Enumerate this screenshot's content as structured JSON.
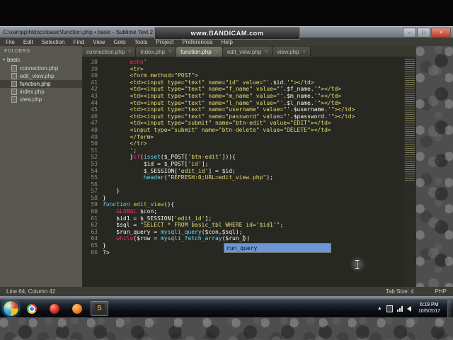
{
  "colors": {
    "editor_bg": "#272822",
    "keyword": "#f92672",
    "string": "#e6db74",
    "function_def": "#a6e22e",
    "builtin": "#66d9ef",
    "text": "#f8f8f2",
    "line_number": "#8f908a",
    "selection_blue": "#6d96d4",
    "close_button": "#bd3a28"
  },
  "watermark": {
    "text": "www.BANDICAM.com"
  },
  "title_bar": {
    "title": "C:\\xampp\\htdocs\\basic\\function.php • basic - Sublime Text 2 (UNREGISTERED)",
    "minimize_glyph": "–",
    "maximize_glyph": "□",
    "close_glyph": "×"
  },
  "menu": {
    "items": [
      "File",
      "Edit",
      "Selection",
      "Find",
      "View",
      "Goto",
      "Tools",
      "Project",
      "Preferences",
      "Help"
    ]
  },
  "tabs": {
    "close_glyph": "×",
    "items": [
      {
        "label": "connection.php",
        "active": false
      },
      {
        "label": "index.php",
        "active": false
      },
      {
        "label": "function.php",
        "active": true
      },
      {
        "label": "edit_view.php",
        "active": false
      },
      {
        "label": "view.php",
        "active": false
      }
    ]
  },
  "sidebar": {
    "header": "FOLDERS",
    "folder_arrow": "▾",
    "root": "basic",
    "selected": "function.php",
    "files": [
      "connection.php",
      "edit_view.php",
      "function.php",
      "index.php",
      "view.php"
    ]
  },
  "editor": {
    "lines": [
      {
        "n": 38,
        "s": [
          [
            "w",
            "        "
          ],
          [
            "k",
            "echo"
          ],
          [
            "s",
            "'"
          ]
        ]
      },
      {
        "n": 39,
        "s": [
          [
            "s",
            "        <tr>"
          ]
        ]
      },
      {
        "n": 40,
        "s": [
          [
            "s",
            "        <form method=\"POST\">"
          ]
        ]
      },
      {
        "n": 41,
        "s": [
          [
            "s",
            "        <td><input type=\"text\" name=\"id\" value=\"'"
          ],
          [
            "w",
            ".$id."
          ],
          [
            "s",
            "'\"></td>"
          ]
        ]
      },
      {
        "n": 42,
        "s": [
          [
            "s",
            "        <td><input type=\"text\" name=\"f_name\" value=\"'"
          ],
          [
            "w",
            ".$f_name."
          ],
          [
            "s",
            "'\"></td>"
          ]
        ]
      },
      {
        "n": 43,
        "s": [
          [
            "s",
            "        <td><input type=\"text\" name=\"m_name\" value=\"'"
          ],
          [
            "w",
            ".$m_name."
          ],
          [
            "s",
            "'\"></td>"
          ]
        ]
      },
      {
        "n": 44,
        "s": [
          [
            "s",
            "        <td><input type=\"text\" name=\"l_name\" value=\"'"
          ],
          [
            "w",
            ".$l_name."
          ],
          [
            "s",
            "'\"></td>"
          ]
        ]
      },
      {
        "n": 45,
        "s": [
          [
            "s",
            "        <td><input type=\"text\" name=\"username\" value=\"'"
          ],
          [
            "w",
            ".$username."
          ],
          [
            "s",
            "'\"></td>"
          ]
        ]
      },
      {
        "n": 46,
        "s": [
          [
            "s",
            "        <td><input type=\"text\" name=\"password\" value=\"'"
          ],
          [
            "w",
            ".$password."
          ],
          [
            "s",
            "'\"></td>"
          ]
        ]
      },
      {
        "n": 47,
        "s": [
          [
            "s",
            "        <td><input type=\"submit\" name=\"btn-edit\" value=\"EDIT\"></td>"
          ]
        ]
      },
      {
        "n": 48,
        "s": [
          [
            "s",
            "        <input type=\"submit\" name=\"btn-delete\" value=\"DELETE\"></td>"
          ]
        ]
      },
      {
        "n": 49,
        "s": [
          [
            "s",
            "        </form>"
          ]
        ]
      },
      {
        "n": 50,
        "s": [
          [
            "s",
            "        </tr>"
          ]
        ]
      },
      {
        "n": 51,
        "s": [
          [
            "s",
            "        '"
          ],
          [
            "w",
            ";"
          ]
        ]
      },
      {
        "n": 52,
        "s": [
          [
            "w",
            "        }"
          ],
          [
            "k",
            "if"
          ],
          [
            "w",
            "("
          ],
          [
            "c",
            "isset"
          ],
          [
            "w",
            "($_POST["
          ],
          [
            "s",
            "'btn-edit'"
          ],
          [
            "w",
            "])){"
          ]
        ]
      },
      {
        "n": 53,
        "s": [
          [
            "w",
            "            $id = $_POST["
          ],
          [
            "s",
            "'id'"
          ],
          [
            "w",
            "];"
          ]
        ]
      },
      {
        "n": 54,
        "s": [
          [
            "w",
            "            $_SESSION["
          ],
          [
            "s",
            "'edit_id'"
          ],
          [
            "w",
            "] = $id;"
          ]
        ]
      },
      {
        "n": 55,
        "s": [
          [
            "w",
            "            "
          ],
          [
            "c",
            "header"
          ],
          [
            "w",
            "("
          ],
          [
            "s",
            "\"REFRESH:0;URL=edit_view.php\""
          ],
          [
            "w",
            ");"
          ]
        ]
      },
      {
        "n": 56,
        "s": []
      },
      {
        "n": 57,
        "s": [
          [
            "w",
            "    }"
          ]
        ]
      },
      {
        "n": 58,
        "s": [
          [
            "w",
            "}"
          ]
        ]
      },
      {
        "n": 59,
        "s": [
          [
            "ci",
            "function"
          ],
          [
            "w",
            " "
          ],
          [
            "g",
            "edit_view"
          ],
          [
            "w",
            "(){"
          ]
        ]
      },
      {
        "n": 60,
        "s": [
          [
            "w",
            "    "
          ],
          [
            "k",
            "GLOBAL"
          ],
          [
            "w",
            " $con;"
          ]
        ]
      },
      {
        "n": 61,
        "s": [
          [
            "w",
            "    $id1 = $_SESSION["
          ],
          [
            "s",
            "'edit_id'"
          ],
          [
            "w",
            "];"
          ]
        ]
      },
      {
        "n": 62,
        "s": [
          [
            "w",
            "    $sql = "
          ],
          [
            "s",
            "\"SELECT * FROM basic_tbl WHERE id='$id1'\""
          ],
          [
            "w",
            ";"
          ]
        ]
      },
      {
        "n": 63,
        "s": [
          [
            "w",
            "    $run_query = "
          ],
          [
            "c",
            "mysqli_query"
          ],
          [
            "w",
            "($con,$sql);"
          ]
        ]
      },
      {
        "n": 64,
        "s": [
          [
            "w",
            "    "
          ],
          [
            "k",
            "while"
          ],
          [
            "w",
            "($row = "
          ],
          [
            "c",
            "mysqli_fetch_array"
          ],
          [
            "w",
            "($run_"
          ],
          [
            "caret",
            ""
          ],
          [
            "w",
            "))"
          ]
        ]
      },
      {
        "n": 65,
        "s": [
          [
            "w",
            "}"
          ]
        ]
      },
      {
        "n": 66,
        "s": [
          [
            "w",
            "?>"
          ]
        ]
      }
    ]
  },
  "autocomplete": {
    "selected_item": "run_query"
  },
  "status_bar": {
    "position": "Line 64, Column 42",
    "tab_size": "Tab Size: 4",
    "syntax": "PHP"
  },
  "taskbar": {
    "clock_time": "6:19 PM",
    "clock_date": "10/5/2017",
    "sublime_glyph": "S"
  }
}
